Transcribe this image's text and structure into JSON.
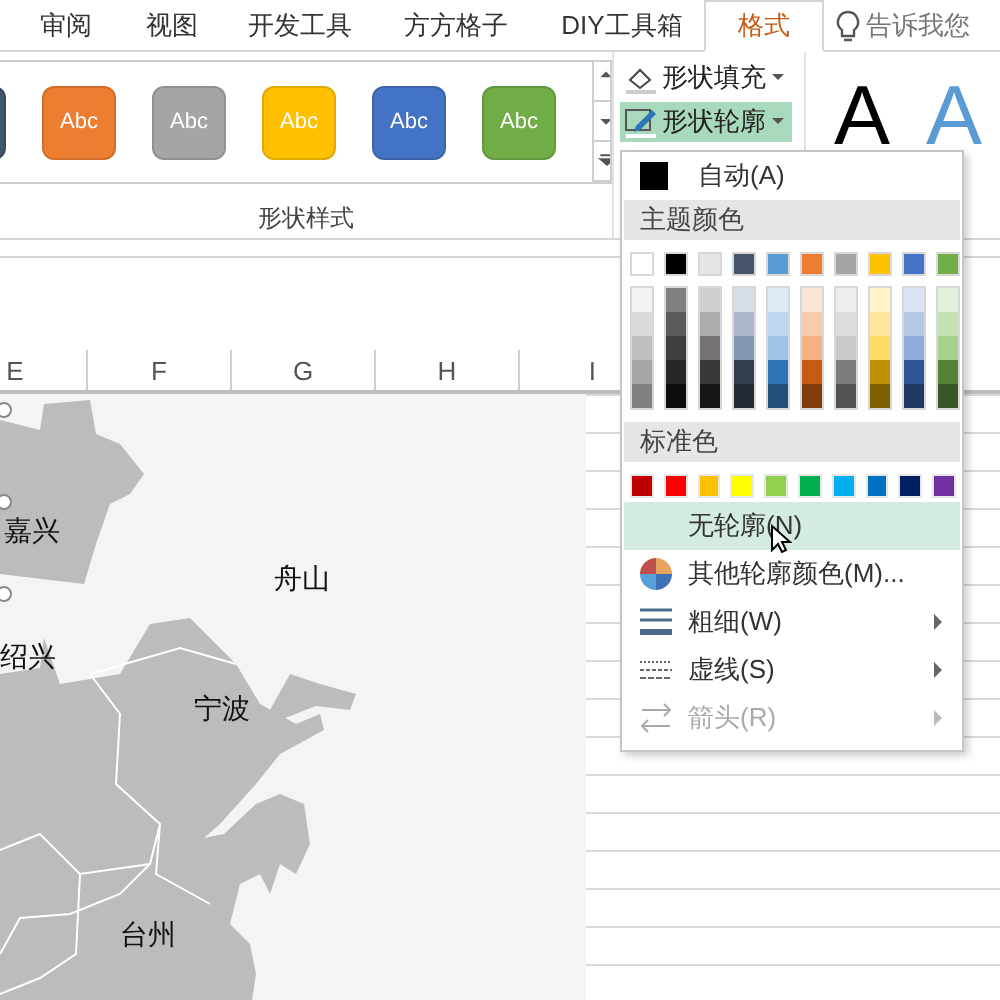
{
  "tabs": [
    {
      "label": "审阅",
      "selected": false
    },
    {
      "label": "视图",
      "selected": false
    },
    {
      "label": "开发工具",
      "selected": false
    },
    {
      "label": "方方格子",
      "selected": false
    },
    {
      "label": "DIY工具箱",
      "selected": false
    },
    {
      "label": "格式",
      "selected": true
    }
  ],
  "search": {
    "placeholder": "告诉我您"
  },
  "shape_styles": {
    "items": [
      {
        "color": "#44546a"
      },
      {
        "label": "Abc",
        "color": "#ed7d31"
      },
      {
        "label": "Abc",
        "color": "#a5a5a5"
      },
      {
        "label": "Abc",
        "color": "#ffc000"
      },
      {
        "label": "Abc",
        "color": "#4472c4"
      },
      {
        "label": "Abc",
        "color": "#70ad47"
      }
    ],
    "group_label": "形状样式"
  },
  "shape_commands": [
    {
      "kind": "fill",
      "label": "形状填充",
      "open": false
    },
    {
      "kind": "outline",
      "label": "形状轮廓",
      "open": true
    }
  ],
  "wordart": [
    {
      "label": "A",
      "color": "#000000"
    },
    {
      "label": "A",
      "color": "#5b9bd5"
    }
  ],
  "columns": [
    "E",
    "F",
    "G",
    "H",
    "I"
  ],
  "map": {
    "labels": [
      "嘉兴",
      "舟山",
      "绍兴",
      "宁波",
      "台州"
    ]
  },
  "outline_menu": {
    "items": [
      {
        "kind": "auto",
        "label": "自动(A)",
        "color": "#000000"
      },
      {
        "kind": "header",
        "label": "主题颜色"
      },
      {
        "kind": "theme_colors",
        "colors": [
          {
            "color": "#ffffff",
            "shades": [
              {
                "color": "#f2f2f2"
              },
              {
                "color": "#d9d9d9"
              },
              {
                "color": "#bfbfbf"
              },
              {
                "color": "#a6a6a6"
              },
              {
                "color": "#808080"
              }
            ]
          },
          {
            "color": "#000000",
            "shades": [
              {
                "color": "#808080"
              },
              {
                "color": "#595959"
              },
              {
                "color": "#404040"
              },
              {
                "color": "#262626"
              },
              {
                "color": "#0d0d0d"
              }
            ]
          },
          {
            "color": "#e7e6e6",
            "shades": [
              {
                "color": "#d0cece"
              },
              {
                "color": "#aeabab"
              },
              {
                "color": "#757171"
              },
              {
                "color": "#3a3838"
              },
              {
                "color": "#171616"
              }
            ]
          },
          {
            "color": "#44546a",
            "shades": [
              {
                "color": "#d6dce4"
              },
              {
                "color": "#adb9ca"
              },
              {
                "color": "#8497b0"
              },
              {
                "color": "#333f4f"
              },
              {
                "color": "#222a35"
              }
            ]
          },
          {
            "color": "#5b9bd5",
            "shades": [
              {
                "color": "#deebf6"
              },
              {
                "color": "#bdd7ee"
              },
              {
                "color": "#9dc3e6"
              },
              {
                "color": "#2e75b5"
              },
              {
                "color": "#1f4e79"
              }
            ]
          },
          {
            "color": "#ed7d31",
            "shades": [
              {
                "color": "#fbe5d5"
              },
              {
                "color": "#f8cbad"
              },
              {
                "color": "#f4b183"
              },
              {
                "color": "#c55a11"
              },
              {
                "color": "#833c0b"
              }
            ]
          },
          {
            "color": "#a5a5a5",
            "shades": [
              {
                "color": "#ededed"
              },
              {
                "color": "#dbdbdb"
              },
              {
                "color": "#c9c9c9"
              },
              {
                "color": "#7b7b7b"
              },
              {
                "color": "#525252"
              }
            ]
          },
          {
            "color": "#ffc000",
            "shades": [
              {
                "color": "#fff2cc"
              },
              {
                "color": "#fee599"
              },
              {
                "color": "#ffd965"
              },
              {
                "color": "#bf9000"
              },
              {
                "color": "#7f6000"
              }
            ]
          },
          {
            "color": "#4472c4",
            "shades": [
              {
                "color": "#dae3f3"
              },
              {
                "color": "#b4c7e7"
              },
              {
                "color": "#8faadc"
              },
              {
                "color": "#2f5597"
              },
              {
                "color": "#203864"
              }
            ]
          },
          {
            "color": "#70ad47",
            "shades": [
              {
                "color": "#e2efd9"
              },
              {
                "color": "#c5e0b3"
              },
              {
                "color": "#a8d08d"
              },
              {
                "color": "#538135"
              },
              {
                "color": "#375623"
              }
            ]
          }
        ]
      },
      {
        "kind": "header",
        "label": "标准色"
      },
      {
        "kind": "standard_colors",
        "colors": [
          {
            "color": "#c00000"
          },
          {
            "color": "#ff0000"
          },
          {
            "color": "#ffc000"
          },
          {
            "color": "#ffff00"
          },
          {
            "color": "#92d050"
          },
          {
            "color": "#00b050"
          },
          {
            "color": "#00b0f0"
          },
          {
            "color": "#0070c0"
          },
          {
            "color": "#002060"
          },
          {
            "color": "#7030a0"
          }
        ]
      },
      {
        "kind": "no_outline",
        "label": "无轮廓(N)",
        "highlighted": true,
        "disabled": false,
        "submenu": false
      },
      {
        "kind": "more_colors",
        "label": "其他轮廓颜色(M)...",
        "highlighted": false,
        "disabled": false,
        "submenu": false
      },
      {
        "kind": "weight",
        "label": "粗细(W)",
        "highlighted": false,
        "disabled": false,
        "submenu": true
      },
      {
        "kind": "dashes",
        "label": "虚线(S)",
        "highlighted": false,
        "disabled": false,
        "submenu": true
      },
      {
        "kind": "arrows",
        "label": "箭头(R)",
        "highlighted": false,
        "disabled": true,
        "submenu": true
      }
    ]
  }
}
